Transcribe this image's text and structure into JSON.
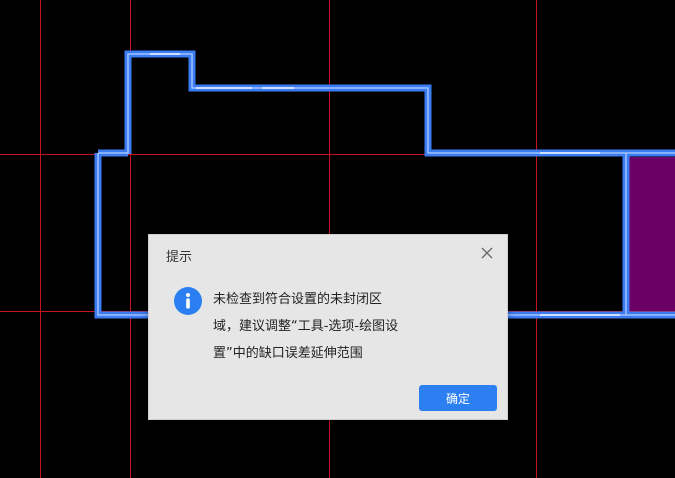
{
  "dialog": {
    "title": "提示",
    "message": "未检查到符合设置的未封闭区域，建议调整“工具-选项-绘图设置”中的缺口误差延伸范围",
    "ok_label": "确定"
  },
  "colors": {
    "background": "#000000",
    "crosshair": "#c8141e",
    "wall": "#3c7cf2",
    "room_fill": "#6a0066",
    "primary_button": "#2b7ff0"
  },
  "icons": {
    "close": "close-icon",
    "info": "info-icon"
  }
}
